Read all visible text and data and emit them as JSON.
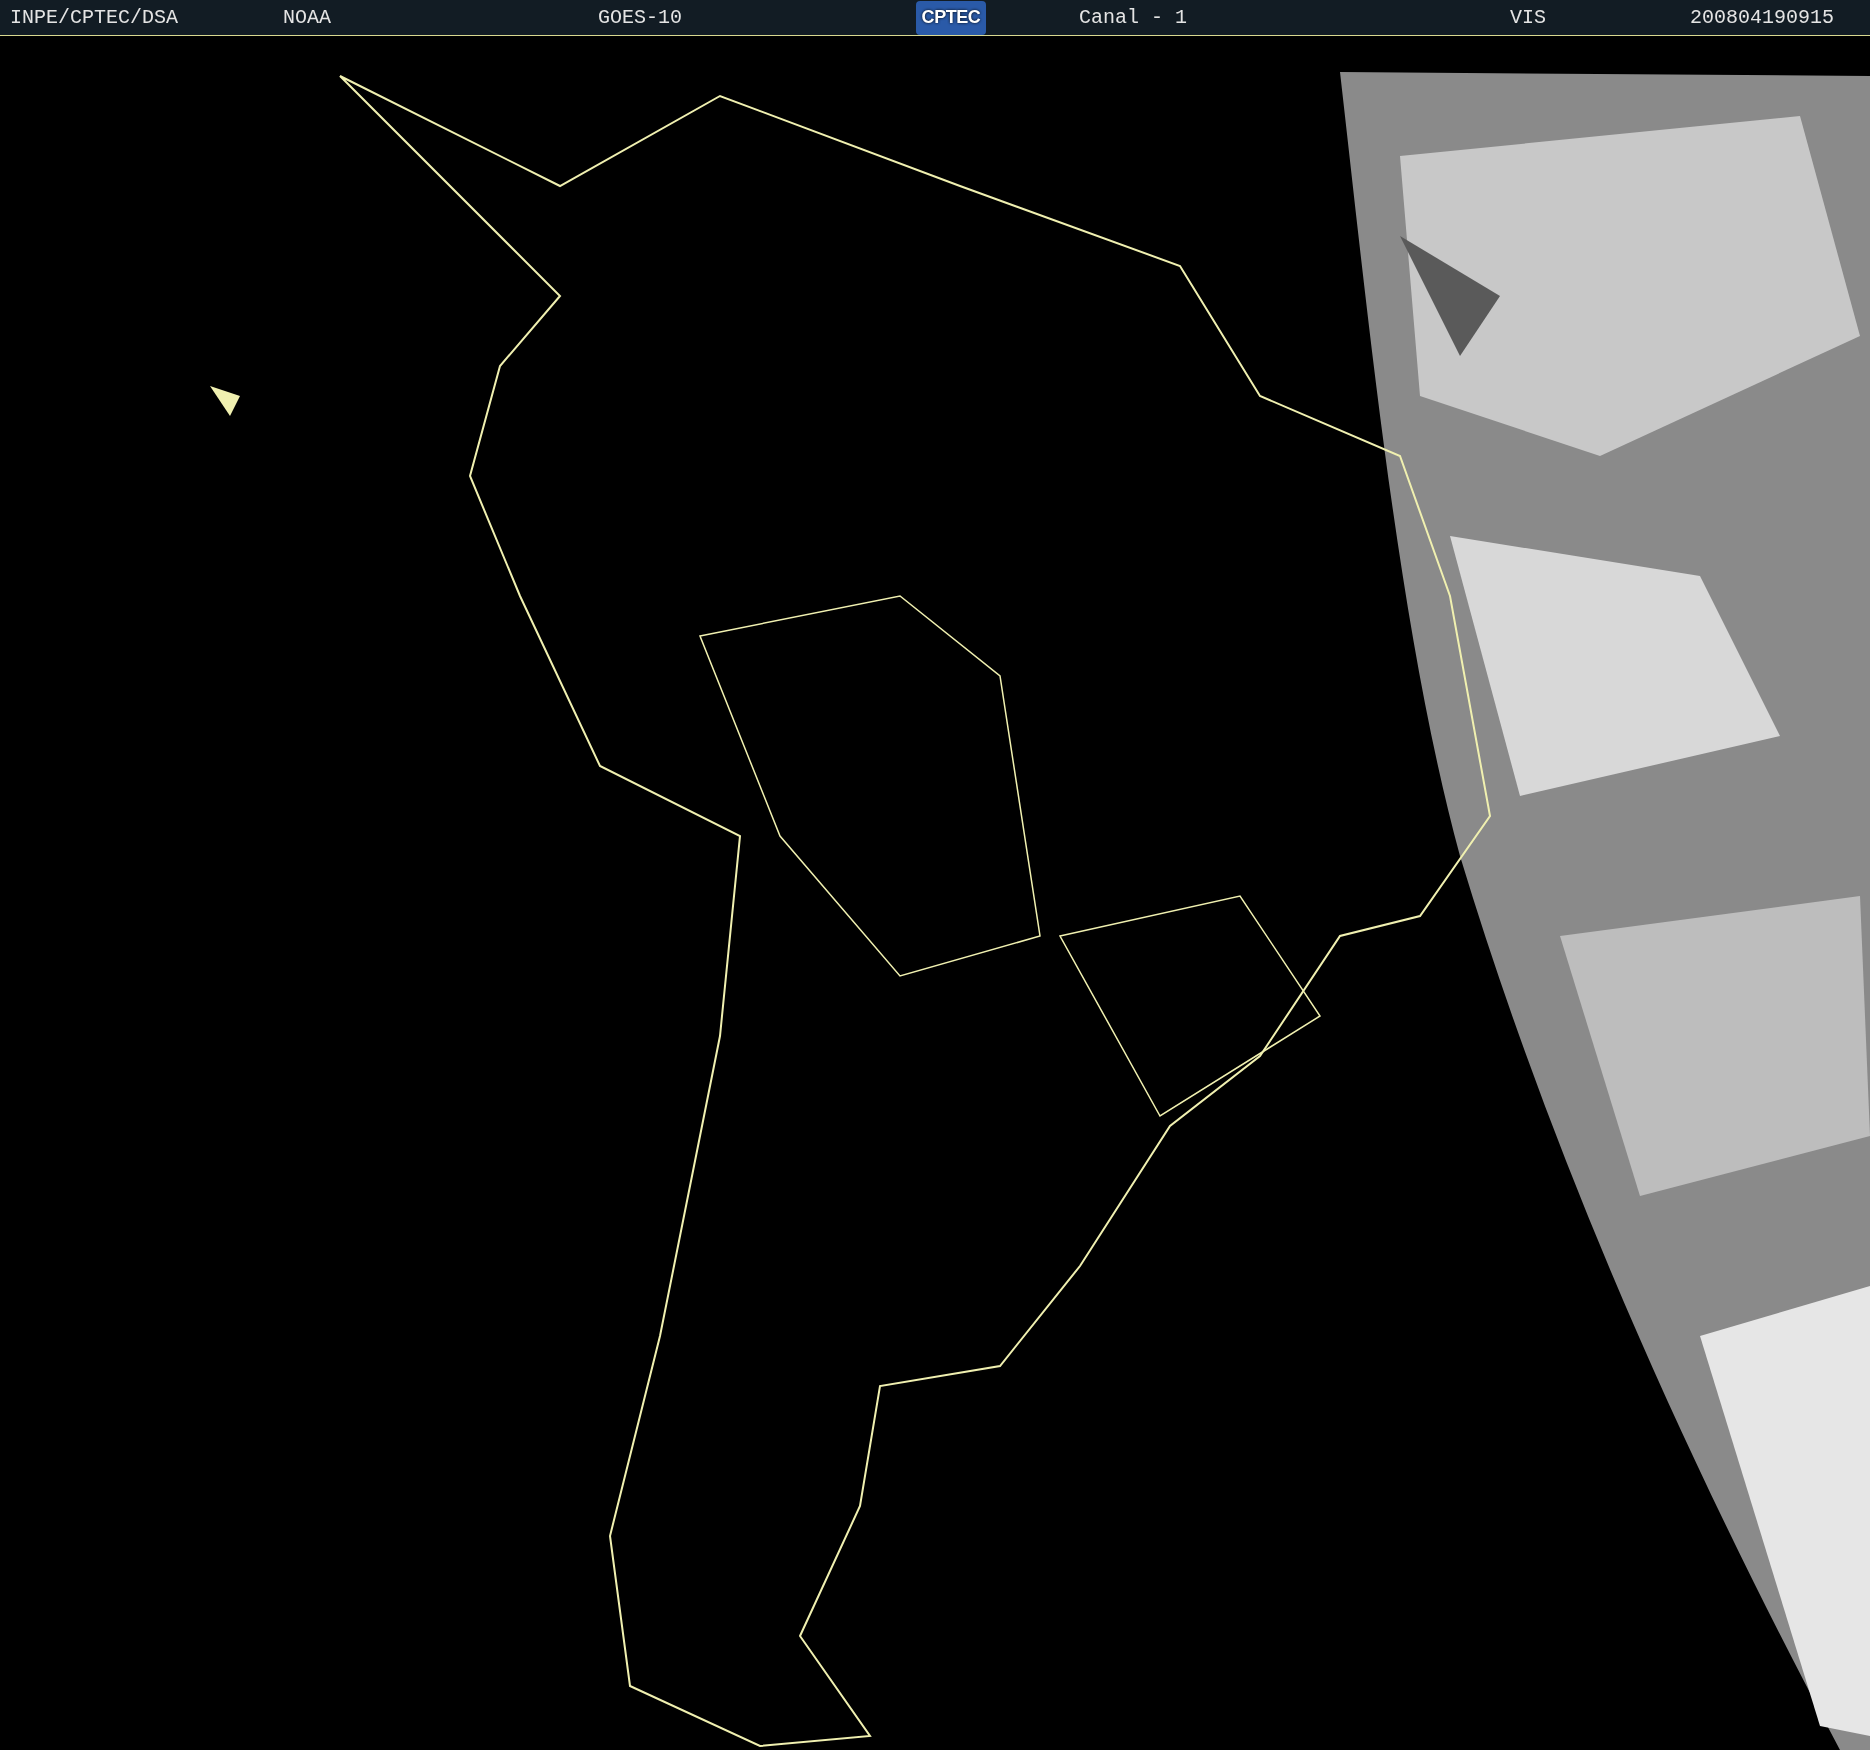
{
  "header": {
    "fields": [
      {
        "text": "INPE/CPTEC/DSA"
      },
      {
        "text": "NOAA"
      },
      {
        "text": "GOES-10"
      },
      {
        "kind": "logo",
        "text": "CPTEC"
      },
      {
        "text": "Canal - 1"
      },
      {
        "text": "VIS"
      },
      {
        "text": "200804190915"
      }
    ]
  }
}
